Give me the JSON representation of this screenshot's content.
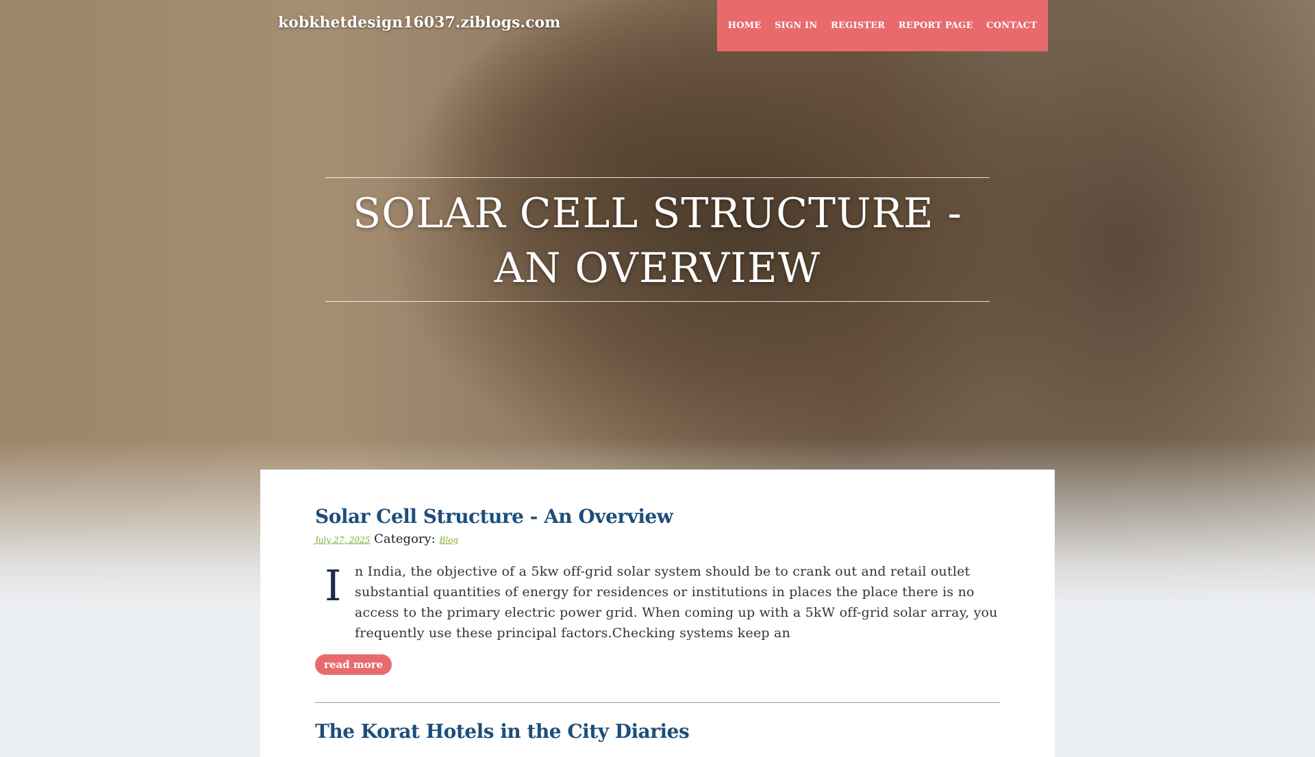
{
  "site": {
    "name": "kobkhetdesign16037.ziblogs.com"
  },
  "nav": {
    "items": [
      {
        "label": "HOME"
      },
      {
        "label": "SIGN IN"
      },
      {
        "label": "REGISTER"
      },
      {
        "label": "REPORT PAGE"
      },
      {
        "label": "CONTACT"
      }
    ]
  },
  "hero": {
    "title": "SOLAR CELL STRUCTURE - AN OVERVIEW"
  },
  "posts": [
    {
      "title": "Solar Cell Structure - An Overview",
      "date": "July 27, 2025",
      "category_label": "Category:",
      "category": "Blog",
      "dropcap": "I",
      "excerpt": "n India, the objective of a 5kw off-grid solar system should be to crank out and retail outlet substantial quantities of energy for residences or institutions in places the place there is no access to the primary electric power grid. When coming up with a 5kW off-grid solar array, you frequently use these principal factors.Checking systems keep an",
      "read_more": "read more"
    },
    {
      "title": "The Korat Hotels in the City Diaries"
    }
  ],
  "colors": {
    "accent": "#e96a6d",
    "title_blue": "#1d4e7a",
    "link_green": "#7bae2a",
    "page_bg": "#edf0f3"
  }
}
